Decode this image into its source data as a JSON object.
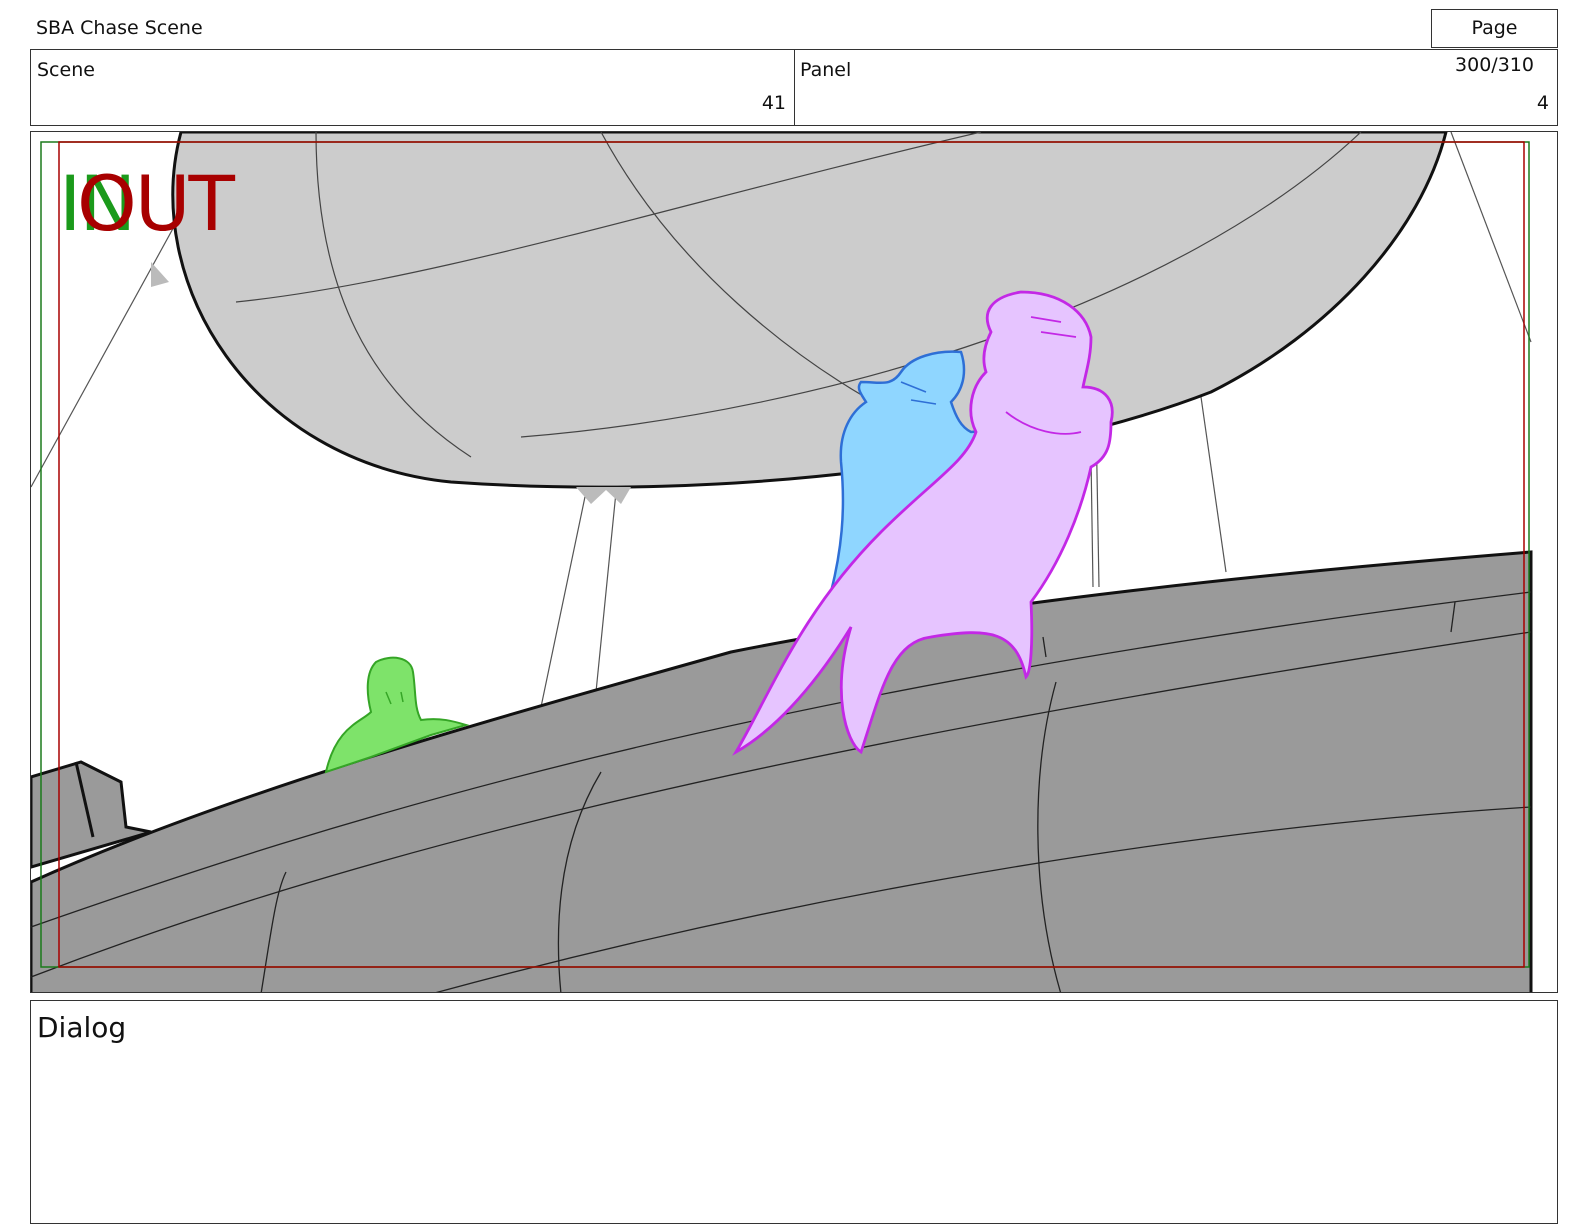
{
  "document": {
    "title": "SBA Chase Scene",
    "page": "Page 300/310"
  },
  "scene": {
    "label": "Scene",
    "value": "41"
  },
  "panel": {
    "label": "Panel",
    "value": "4"
  },
  "frame": {
    "safe_area_in": "IN",
    "safe_area_out": "OUT",
    "colors": {
      "sky": "#ffffff",
      "balloon": "#cccccc",
      "deck": "#9a9a9a",
      "in_guide": "#1b7a1b",
      "out_guide": "#a80000",
      "character_green": "#7ee36a",
      "character_blue": "#8fd6ff",
      "character_purple": "#e6c4ff"
    }
  },
  "dialog": {
    "label": "Dialog",
    "text": ""
  }
}
